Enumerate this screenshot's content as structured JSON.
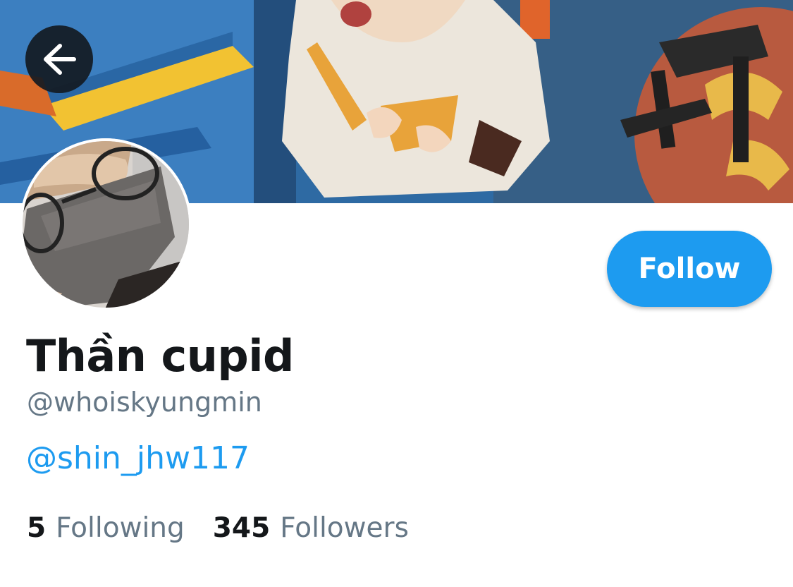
{
  "header": {
    "back_icon": "arrow-left-icon"
  },
  "profile": {
    "display_name": "Thần cupid",
    "handle": "@whoiskyungmin",
    "bio_link": "@shin_jhw117",
    "follow_label": "Follow",
    "stats": {
      "following_count": "5",
      "following_label": "Following",
      "followers_count": "345",
      "followers_label": "Followers"
    }
  },
  "colors": {
    "accent": "#1d9bf0",
    "text_primary": "#14171a",
    "text_secondary": "#657786"
  }
}
